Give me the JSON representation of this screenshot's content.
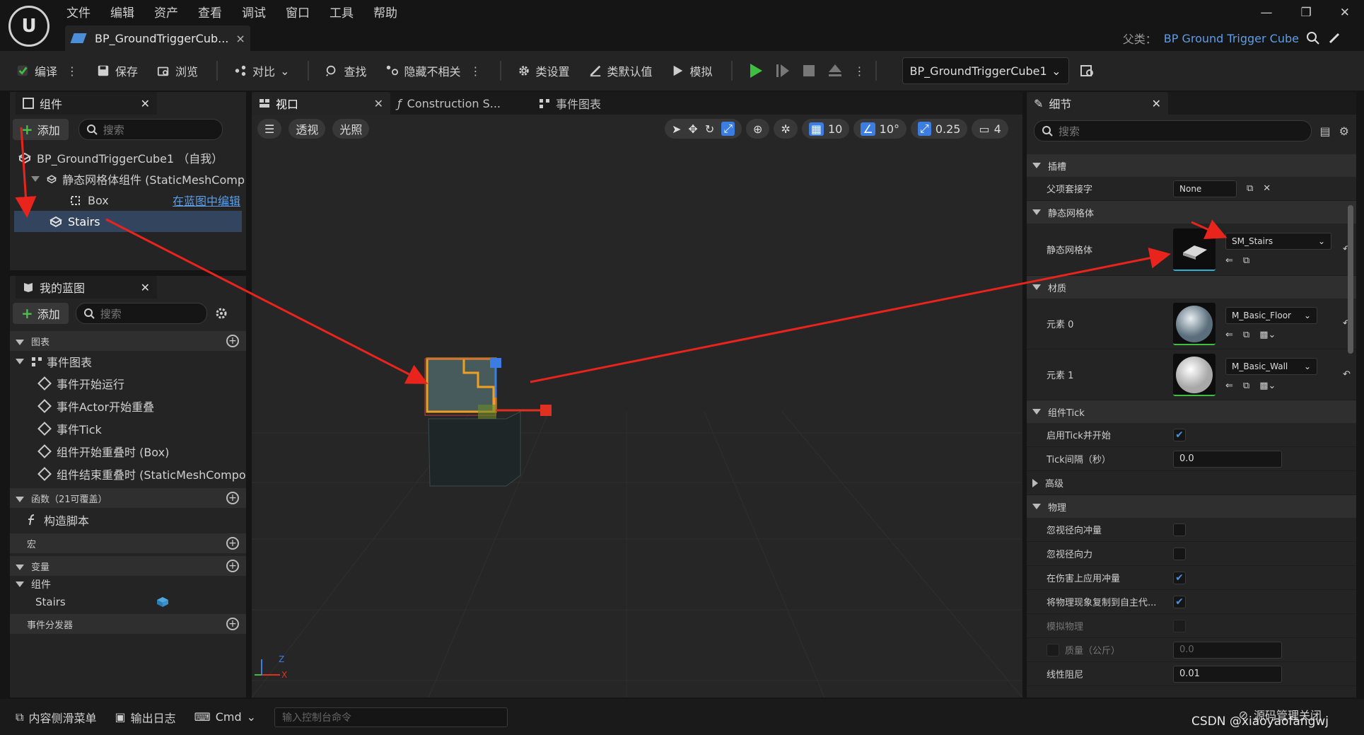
{
  "titlebar": {
    "logo": "U",
    "menu": [
      "文件",
      "编辑",
      "资产",
      "查看",
      "调试",
      "窗口",
      "工具",
      "帮助"
    ],
    "tab_title": "BP_GroundTriggerCub...",
    "tab_close": "×",
    "parent_label": "父类：",
    "parent_value": "BP Ground Trigger Cube",
    "win_minimize": "—",
    "win_restore": "❐",
    "win_close": "✕"
  },
  "toolbar": {
    "compile": "编译",
    "save": "保存",
    "browse": "浏览",
    "diff": "对比",
    "find": "查找",
    "hide_unrelated": "隐藏不相关",
    "class_settings": "类设置",
    "class_defaults": "类默认值",
    "simulate": "模拟",
    "debug_object": "BP_GroundTriggerCube1"
  },
  "components": {
    "title": "组件",
    "add": "添加",
    "search_placeholder": "搜索",
    "root": "BP_GroundTriggerCube1 （自我）",
    "static_mesh": "静态网格体组件 (StaticMeshComp",
    "box": "Box",
    "edit_in_bp": "在蓝图中编辑",
    "stairs": "Stairs"
  },
  "my_blueprint": {
    "title": "我的蓝图",
    "add": "添加",
    "search_placeholder": "搜索",
    "graphs_label": "图表",
    "event_graph": "事件图表",
    "events": [
      "事件开始运行",
      "事件Actor开始重叠",
      "事件Tick",
      "组件开始重叠时 (Box)",
      "组件结束重叠时 (StaticMeshCompo"
    ],
    "functions_label": "函数（21可覆盖）",
    "construction_script": "构造脚本",
    "macros_label": "宏",
    "variables_label": "变量",
    "components_group": "组件",
    "var_stairs": "Stairs",
    "dispatchers_label": "事件分发器"
  },
  "viewport": {
    "tab_viewport": "视口",
    "tab_construction": "Construction S...",
    "tab_event_graph": "事件图表",
    "perspective": "透视",
    "lighting": "光照",
    "grid_snap": "10",
    "rot_snap": "10°",
    "scale_snap": "0.25",
    "camera_speed": "4",
    "axis_z": "Z",
    "axis_x": "X"
  },
  "details": {
    "title": "细节",
    "search_placeholder": "搜索",
    "socket_section": "插槽",
    "parent_socket_label": "父项套接字",
    "parent_socket_value": "None",
    "static_mesh_section": "静态网格体",
    "static_mesh_label": "静态网格体",
    "static_mesh_value": "SM_Stairs",
    "materials_section": "材质",
    "element0_label": "元素 0",
    "element0_value": "M_Basic_Floor",
    "element1_label": "元素 1",
    "element1_value": "M_Basic_Wall",
    "tick_section": "组件Tick",
    "tick_start_label": "启用Tick并开始",
    "tick_interval_label": "Tick间隔（秒）",
    "tick_interval_value": "0.0",
    "advanced_label": "高级",
    "physics_section": "物理",
    "ignore_radial_impulse": "忽视径向冲量",
    "ignore_radial_force": "忽视径向力",
    "apply_impulse_on_damage": "在伤害上应用冲量",
    "replicate_physics": "将物理现象复制到自主代...",
    "simulate_physics": "模拟物理",
    "mass_label": "质量（公斤）",
    "mass_value": "0.0",
    "linear_damping_label": "线性阻尼",
    "linear_damping_value": "0.01"
  },
  "statusbar": {
    "content_drawer": "内容侧滑菜单",
    "output_log": "输出日志",
    "cmd": "Cmd",
    "console_placeholder": "输入控制台命令",
    "source_control": "源码管理关闭",
    "watermark": "CSDN @xiaoyaofangwj"
  },
  "colors": {
    "accent_blue": "#4a90e2",
    "play_green": "#3fbf3f",
    "annotation_red": "#e8241c"
  }
}
